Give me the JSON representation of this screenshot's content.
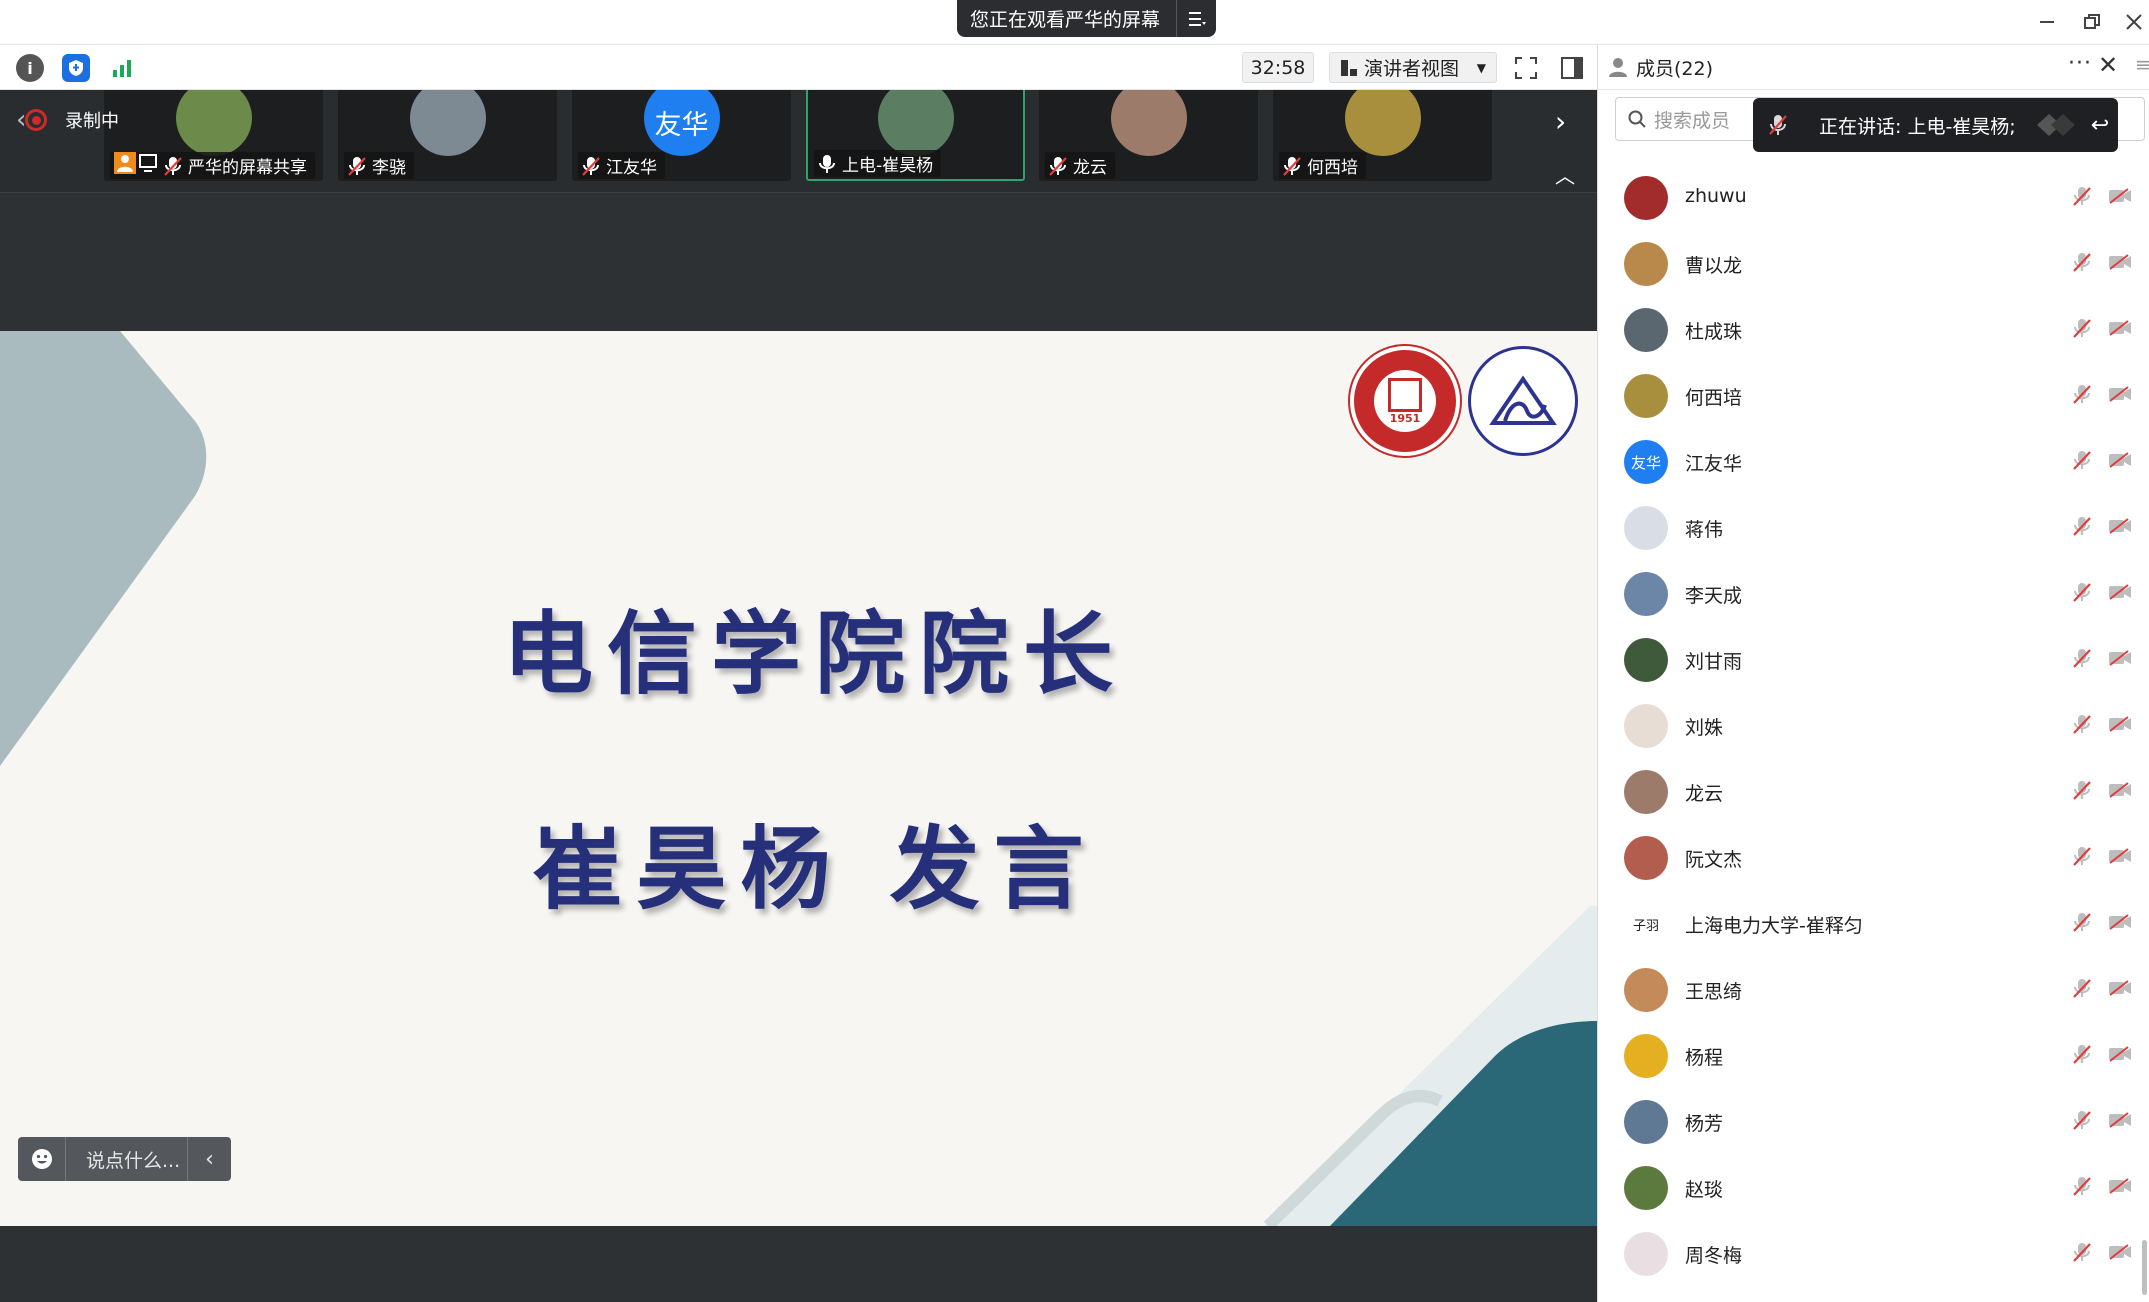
{
  "titlebar": {
    "share_notice": "您正在观看严华的屏幕",
    "menu_icon": "list-icon",
    "minimize_icon": "minimize-icon",
    "restore_icon": "restore-icon",
    "close_icon": "close-icon"
  },
  "toolbar": {
    "info_icon": "info-icon",
    "shield_icon": "shield-icon",
    "signal_icon": "signal-icon",
    "timer": "32:58",
    "view_mode": "演讲者视图",
    "fullscreen_icon": "fullscreen-icon",
    "sidebar_icon": "sidebar-toggle-icon"
  },
  "strip": {
    "recording_label": "录制中",
    "thumbnails": [
      {
        "name": "严华的屏幕共享",
        "muted": true,
        "avatar_text": "",
        "color": "#6c8a4a"
      },
      {
        "name": "李骁",
        "muted": true,
        "avatar_text": "",
        "color": "#7d8a93"
      },
      {
        "name": "江友华",
        "muted": true,
        "avatar_text": "友华",
        "color": "#1f7ff0"
      },
      {
        "name": "上电-崔昊杨",
        "muted": false,
        "avatar_text": "",
        "color": "#5b7d62"
      },
      {
        "name": "龙云",
        "muted": true,
        "avatar_text": "",
        "color": "#9c7b6a"
      },
      {
        "name": "何西培",
        "muted": true,
        "avatar_text": "",
        "color": "#a88f3d"
      }
    ]
  },
  "slide": {
    "title_line1": "电信学院院长",
    "title_line2": "崔昊杨 发言",
    "logo1_text": "1951",
    "colors": {
      "title": "#252f7a",
      "teal": "#2a6878",
      "slate": "#a9bbbf"
    }
  },
  "chat": {
    "placeholder": "说点什么..."
  },
  "panel": {
    "header": "成员(22)",
    "search_placeholder": "搜索成员",
    "speaking": "正在讲话: 上电-崔昊杨;",
    "members": [
      {
        "name": "zhuwu",
        "avatar_text": "",
        "color": "#a22c2c"
      },
      {
        "name": "曹以龙",
        "avatar_text": "",
        "color": "#b8894a"
      },
      {
        "name": "杜成珠",
        "avatar_text": "",
        "color": "#5b6770"
      },
      {
        "name": "何西培",
        "avatar_text": "",
        "color": "#a88f3d"
      },
      {
        "name": "江友华",
        "avatar_text": "友华",
        "color": "#1f7ff0"
      },
      {
        "name": "蒋伟",
        "avatar_text": "",
        "color": "#d9dee6"
      },
      {
        "name": "李天成",
        "avatar_text": "",
        "color": "#6b86a6"
      },
      {
        "name": "刘甘雨",
        "avatar_text": "",
        "color": "#3f5a3a"
      },
      {
        "name": "刘姝",
        "avatar_text": "",
        "color": "#e7ddd5"
      },
      {
        "name": "龙云",
        "avatar_text": "",
        "color": "#9c7b6a"
      },
      {
        "name": "阮文杰",
        "avatar_text": "",
        "color": "#b35d4e"
      },
      {
        "name": "上海电力大学-崔释匀",
        "avatar_text": "子羽",
        "color": "#ffffff"
      },
      {
        "name": "王思绮",
        "avatar_text": "",
        "color": "#c58a5a"
      },
      {
        "name": "杨程",
        "avatar_text": "",
        "color": "#e4b021"
      },
      {
        "name": "杨芳",
        "avatar_text": "",
        "color": "#5f7894"
      },
      {
        "name": "赵琰",
        "avatar_text": "",
        "color": "#5c7a3e"
      },
      {
        "name": "周冬梅",
        "avatar_text": "",
        "color": "#e9dfe2"
      }
    ]
  }
}
